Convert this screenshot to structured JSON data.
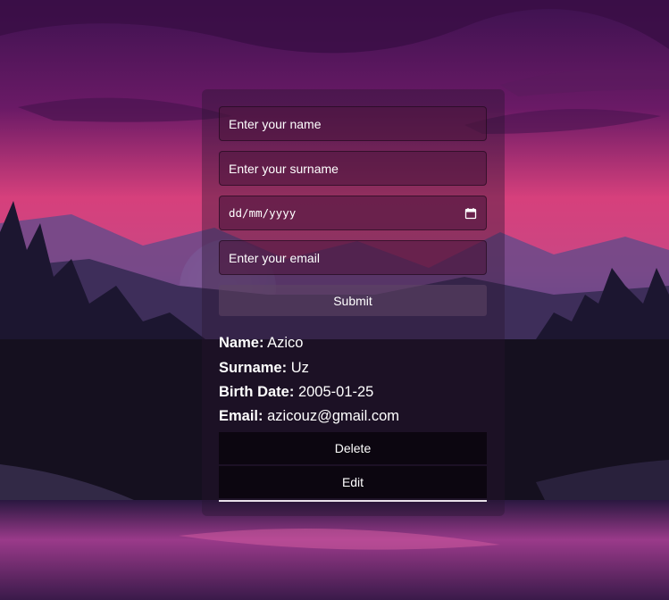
{
  "form": {
    "name_placeholder": "Enter your name",
    "surname_placeholder": "Enter your surname",
    "date_placeholder": "dd/mm/yyyy",
    "email_placeholder": "Enter your email",
    "submit_label": "Submit"
  },
  "record": {
    "name_label": "Name:",
    "name_value": "Azico",
    "surname_label": "Surname:",
    "surname_value": "Uz",
    "birth_label": "Birth Date:",
    "birth_value": "2005-01-25",
    "email_label": "Email:",
    "email_value": "azicouz@gmail.com"
  },
  "actions": {
    "delete_label": "Delete",
    "edit_label": "Edit"
  },
  "icons": {
    "date_picker": "calendar-icon"
  },
  "colors": {
    "sky_pink": "#e0437f",
    "sky_purple": "#5a1a5e",
    "text": "#ffffff"
  }
}
